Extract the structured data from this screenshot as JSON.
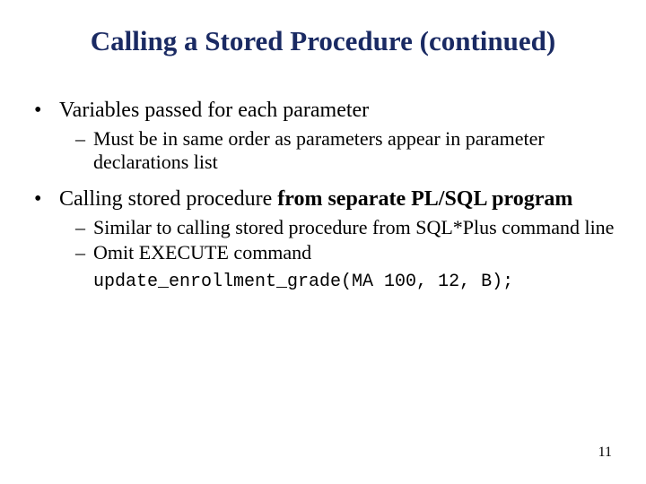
{
  "title": "Calling a Stored Procedure (continued)",
  "b1": "Variables passed for each parameter",
  "b1s1": "Must be in same order as parameters appear in parameter declarations list",
  "b2a": "Calling stored procedure ",
  "b2b": "from separate PL/SQL program",
  "b2s1": "Similar to calling stored procedure from SQL*Plus command line",
  "b2s2": "Omit EXECUTE command",
  "code": "update_enrollment_grade(MA 100, 12, B);",
  "page": "11"
}
